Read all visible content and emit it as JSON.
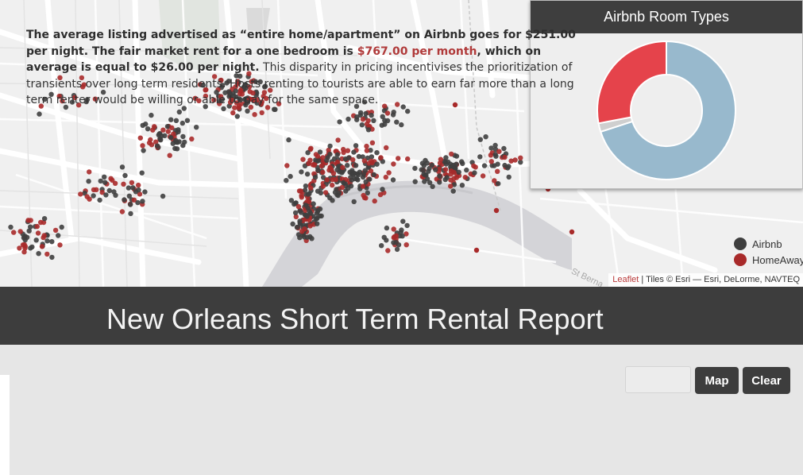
{
  "map": {
    "attribution_link": "Leaflet",
    "attribution_text": " | Tiles © Esri — Esri, DeLorme, NAVTEQ",
    "street_label": "St Berna",
    "legend": [
      {
        "label": "Airbnb",
        "color": "#3f3f3f"
      },
      {
        "label": "HomeAway",
        "color": "#a82a2a"
      }
    ]
  },
  "chart_panel": {
    "title": "Airbnb Room Types"
  },
  "chart_data": {
    "type": "pie",
    "title": "Airbnb Room Types",
    "slices": [
      {
        "value": 70,
        "color": "#98b9cd"
      },
      {
        "value": 2,
        "color": "#cfcfcf"
      },
      {
        "value": 28,
        "color": "#e5434b"
      }
    ]
  },
  "header": {
    "title": "New Orleans Short Term Rental Report"
  },
  "report": {
    "bold_intro": "The average listing advertised as “entire home/apartment” on Airbnb goes for $251.00 per night. The fair market rent for a one bedroom is ",
    "rent_highlight": "$767.00 per month",
    "bold_tail": ", which on average is equal to $26.00 per night.",
    "body": " This disparity in pricing incentivises the prioritization of transients over long term residents. Hosts renting to tourists are able to earn far more than a long term renter would be willing or able to pay for the same space."
  },
  "controls": {
    "search_value": "",
    "map_button": "Map",
    "clear_button": "Clear"
  }
}
